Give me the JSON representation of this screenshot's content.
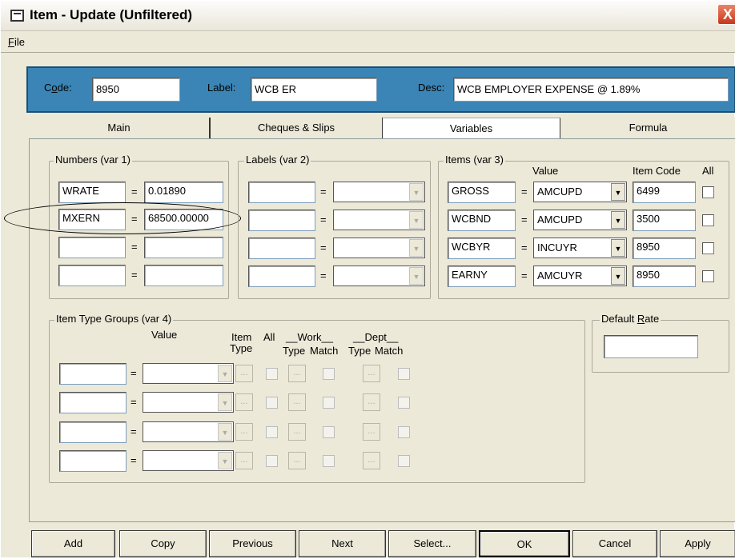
{
  "window": {
    "title": "Item - Update (Unfiltered)",
    "close": "X"
  },
  "menu": {
    "file_mnemonic": "F",
    "file_rest": "ile"
  },
  "header": {
    "code_label_pre": "C",
    "code_label_u": "o",
    "code_label_post": "de:",
    "code_value": "8950",
    "label_label": "Label:",
    "label_value": "WCB ER",
    "desc_label": "Desc:",
    "desc_value": "WCB EMPLOYER EXPENSE @ 1.89%"
  },
  "tabs": [
    {
      "label": "Main"
    },
    {
      "label": "Cheques & Slips"
    },
    {
      "label": "Variables"
    },
    {
      "label": "Formula"
    }
  ],
  "numbers": {
    "title": "Numbers (var 1)",
    "rows": [
      {
        "name": "WRATE",
        "value": "0.01890"
      },
      {
        "name": "MXERN",
        "value": "68500.00000"
      },
      {
        "name": "",
        "value": ""
      },
      {
        "name": "",
        "value": ""
      }
    ]
  },
  "labels_group": {
    "title": "Labels (var 2)"
  },
  "items": {
    "title": "Items (var 3)",
    "col_value": "Value",
    "col_item_code": "Item Code",
    "col_all": "All",
    "rows": [
      {
        "name": "GROSS",
        "value": "AMCUPD",
        "code": "6499"
      },
      {
        "name": "WCBND",
        "value": "AMCUPD",
        "code": "3500"
      },
      {
        "name": "WCBYR",
        "value": "INCUYR",
        "code": "8950"
      },
      {
        "name": "EARNY",
        "value": "AMCUYR",
        "code": "8950"
      }
    ]
  },
  "itg": {
    "title": "Item Type Groups (var 4)",
    "col_value": "Value",
    "col_item": "Item",
    "col_type": "Type",
    "col_all": "All",
    "col_work": "__Work__",
    "col_dept": "__Dept__",
    "col_type2": "Type",
    "col_match": "Match",
    "col_type3": "Type",
    "col_match2": "Match"
  },
  "default_rate": {
    "title_pre": "Default ",
    "title_u": "R",
    "title_post": "ate",
    "value": ""
  },
  "eq": "=",
  "ellipsis": "...",
  "buttons": {
    "add": "Add",
    "copy": "Copy",
    "previous": "Previous",
    "next": "Next",
    "select": "Select...",
    "ok": "OK",
    "cancel": "Cancel",
    "apply": "Apply"
  }
}
